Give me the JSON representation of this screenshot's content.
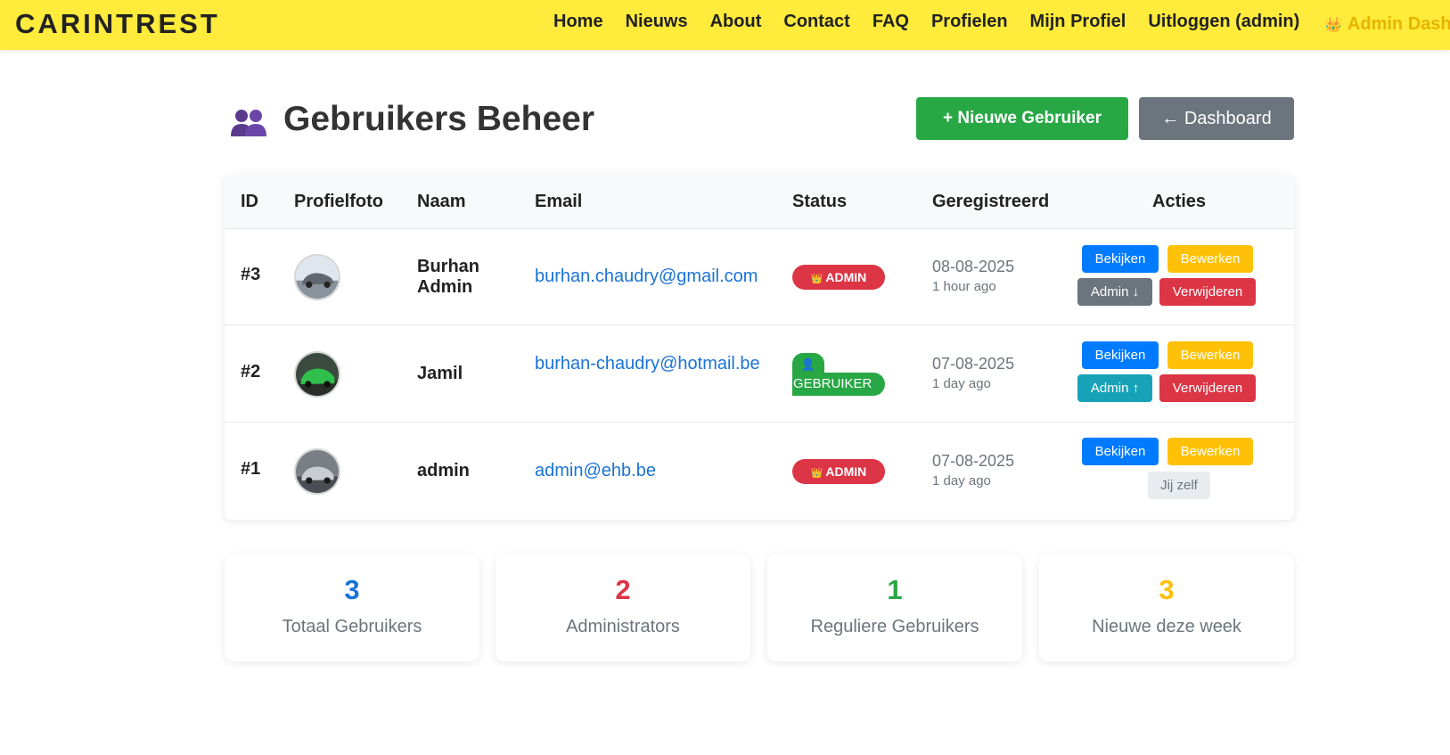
{
  "nav": {
    "brand": "CARINTREST",
    "links": [
      "Home",
      "Nieuws",
      "About",
      "Contact",
      "FAQ",
      "Profielen",
      "Mijn Profiel",
      "Uitloggen (admin)"
    ],
    "admin_link": "Admin Dash",
    "admin_icon": "crown-icon"
  },
  "header": {
    "icon": "users-icon",
    "title": "Gebruikers Beheer",
    "new_user_button": "+ Nieuwe Gebruiker",
    "dashboard_button": "← Dashboard"
  },
  "table": {
    "columns": [
      "ID",
      "Profielfoto",
      "Naam",
      "Email",
      "Status",
      "Geregistreerd",
      "Acties"
    ],
    "rows": [
      {
        "id": "#3",
        "name": "Burhan Admin",
        "email": "burhan.chaudry@gmail.com",
        "status": "ADMIN",
        "date": "08-08-2025",
        "ago": "1 hour ago",
        "actions": [
          "Bekijken",
          "Bewerken",
          "Admin ↓",
          "Verwijderen"
        ]
      },
      {
        "id": "#2",
        "name": "Jamil",
        "email": "burhan-chaudry@hotmail.be",
        "status": "GEBRUIKER",
        "date": "07-08-2025",
        "ago": "1 day ago",
        "actions": [
          "Bekijken",
          "Bewerken",
          "Admin ↑",
          "Verwijderen"
        ]
      },
      {
        "id": "#1",
        "name": "admin",
        "email": "admin@ehb.be",
        "status": "ADMIN",
        "date": "07-08-2025",
        "ago": "1 day ago",
        "actions": [
          "Bekijken",
          "Bewerken",
          "Jij zelf"
        ]
      }
    ]
  },
  "stats": [
    {
      "value": "3",
      "label": "Totaal Gebruikers",
      "color": "#1a73d6"
    },
    {
      "value": "2",
      "label": "Administrators",
      "color": "#dc3545"
    },
    {
      "value": "1",
      "label": "Reguliere Gebruikers",
      "color": "#28a745"
    },
    {
      "value": "3",
      "label": "Nieuwe deze week",
      "color": "#ffc107"
    }
  ],
  "colors": {
    "navbar": "#ffeb3b",
    "primary": "#007bff",
    "success": "#28a745",
    "warning": "#ffc107",
    "danger": "#dc3545",
    "secondary": "#6c757d",
    "info": "#17a2b8"
  }
}
